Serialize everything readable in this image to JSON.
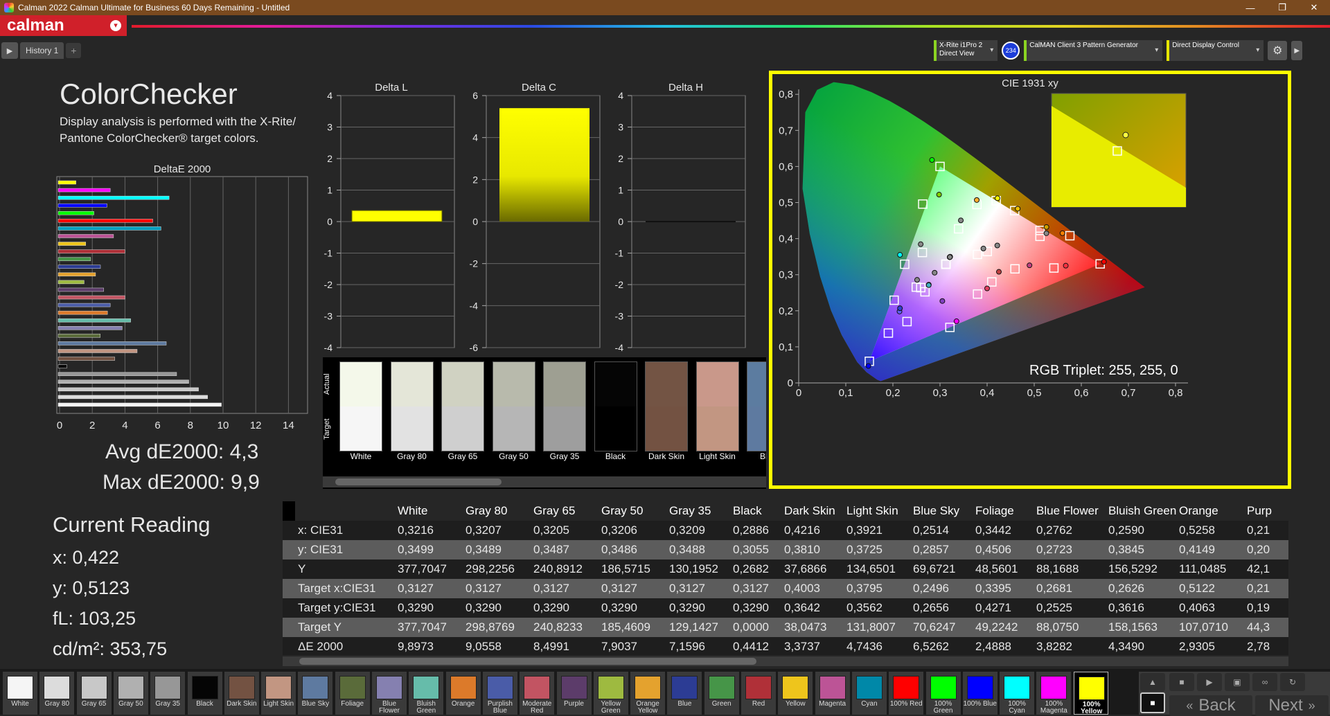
{
  "window": {
    "title": "Calman 2022 Calman Ultimate for Business 60 Days Remaining  - Untitled",
    "min": "—",
    "max": "❐",
    "close": "✕"
  },
  "app": {
    "logo": "calman",
    "logo_chevron": "▾"
  },
  "tabs": {
    "play": "▶",
    "history": "History 1",
    "add": "+"
  },
  "devices": {
    "meter_line1": "X-Rite i1Pro 2",
    "meter_line2": "Direct View",
    "badge": "234",
    "pattern": "CalMAN Client 3 Pattern Generator",
    "display": "Direct Display Control",
    "dropdown": "▾",
    "gear": "⚙",
    "side": "▶"
  },
  "heading": {
    "title": "ColorChecker",
    "desc": "Display analysis is performed with the X-Rite/ Pantone ColorChecker® target colors."
  },
  "deltae_chart": {
    "title": "DeltaE 2000",
    "ticks": [
      "0",
      "2",
      "4",
      "6",
      "8",
      "10",
      "12",
      "14"
    ],
    "xmax": 15
  },
  "stats": {
    "avg": "Avg dE2000: 4,3",
    "max": "Max dE2000: 9,9"
  },
  "delta_l": {
    "title": "Delta L",
    "ticks": [
      "4",
      "3",
      "2",
      "1",
      "0",
      "-1",
      "-2",
      "-3",
      "-4"
    ]
  },
  "delta_c": {
    "title": "Delta C",
    "ticks": [
      "6",
      "4",
      "2",
      "0",
      "-2",
      "-4",
      "-6"
    ]
  },
  "delta_h": {
    "title": "Delta H",
    "ticks": [
      "4",
      "3",
      "2",
      "1",
      "0",
      "-1",
      "-2",
      "-3",
      "-4"
    ]
  },
  "swatches": {
    "actual_label": "Actual",
    "target_label": "Target",
    "items": [
      {
        "label": "White",
        "actual": "#f4f8ea",
        "target": "#f6f6f6"
      },
      {
        "label": "Gray 80",
        "actual": "#e4e6d8",
        "target": "#e2e2e2"
      },
      {
        "label": "Gray 65",
        "actual": "#d0d2c2",
        "target": "#cfcfcf"
      },
      {
        "label": "Gray 50",
        "actual": "#b8baac",
        "target": "#b6b6b6"
      },
      {
        "label": "Gray 35",
        "actual": "#9e9f92",
        "target": "#9e9e9e"
      },
      {
        "label": "Black",
        "actual": "#050505",
        "target": "#000000"
      },
      {
        "label": "Dark Skin",
        "actual": "#735444",
        "target": "#735242"
      },
      {
        "label": "Light Skin",
        "actual": "#c9988a",
        "target": "#c29682"
      },
      {
        "label": "Blue",
        "actual": "#5c7ca0",
        "target": "#5e7aa0"
      }
    ]
  },
  "cie": {
    "title": "CIE 1931 xy",
    "rgb_triplet": "RGB Triplet: 255, 255, 0",
    "xticks": [
      "0",
      "0,1",
      "0,2",
      "0,3",
      "0,4",
      "0,5",
      "0,6",
      "0,7",
      "0,8"
    ],
    "yticks": [
      "0",
      "0,1",
      "0,2",
      "0,3",
      "0,4",
      "0,5",
      "0,6",
      "0,7",
      "0,8"
    ]
  },
  "reading": {
    "title": "Current Reading",
    "x": "x: 0,422",
    "y": "y: 0,5123",
    "fl": "fL: 103,25",
    "cd": "cd/m²: 353,75"
  },
  "table": {
    "columns": [
      "White",
      "Gray 80",
      "Gray 65",
      "Gray 50",
      "Gray 35",
      "Black",
      "Dark Skin",
      "Light Skin",
      "Blue Sky",
      "Foliage",
      "Blue Flower",
      "Bluish Green",
      "Orange",
      "Purp"
    ],
    "rows": [
      {
        "label": "x: CIE31",
        "values": [
          "0,3216",
          "0,3207",
          "0,3205",
          "0,3206",
          "0,3209",
          "0,2886",
          "0,4216",
          "0,3921",
          "0,2514",
          "0,3442",
          "0,2762",
          "0,2590",
          "0,5258",
          "0,21"
        ]
      },
      {
        "label": "y: CIE31",
        "values": [
          "0,3499",
          "0,3489",
          "0,3487",
          "0,3486",
          "0,3488",
          "0,3055",
          "0,3810",
          "0,3725",
          "0,2857",
          "0,4506",
          "0,2723",
          "0,3845",
          "0,4149",
          "0,20"
        ]
      },
      {
        "label": "Y",
        "values": [
          "377,7047",
          "298,2256",
          "240,8912",
          "186,5715",
          "130,1952",
          "0,2682",
          "37,6866",
          "134,6501",
          "69,6721",
          "48,5601",
          "88,1688",
          "156,5292",
          "111,0485",
          "42,1"
        ]
      },
      {
        "label": "Target x:CIE31",
        "values": [
          "0,3127",
          "0,3127",
          "0,3127",
          "0,3127",
          "0,3127",
          "0,3127",
          "0,4003",
          "0,3795",
          "0,2496",
          "0,3395",
          "0,2681",
          "0,2626",
          "0,5122",
          "0,21"
        ]
      },
      {
        "label": "Target y:CIE31",
        "values": [
          "0,3290",
          "0,3290",
          "0,3290",
          "0,3290",
          "0,3290",
          "0,3290",
          "0,3642",
          "0,3562",
          "0,2656",
          "0,4271",
          "0,2525",
          "0,3616",
          "0,4063",
          "0,19"
        ]
      },
      {
        "label": "Target Y",
        "values": [
          "377,7047",
          "298,8769",
          "240,8233",
          "185,4609",
          "129,1427",
          "0,0000",
          "38,0473",
          "131,8007",
          "70,6247",
          "49,2242",
          "88,0750",
          "158,1563",
          "107,0710",
          "44,3"
        ]
      },
      {
        "label": "ΔE 2000",
        "values": [
          "9,8973",
          "9,0558",
          "8,4991",
          "7,9037",
          "7,1596",
          "0,4412",
          "3,3737",
          "4,7436",
          "6,5262",
          "2,4888",
          "3,8282",
          "4,3490",
          "2,9305",
          "2,78"
        ]
      }
    ]
  },
  "patches": [
    {
      "label": "White",
      "color": "#f5f5f5"
    },
    {
      "label": "Gray 80",
      "color": "#dcdcdc"
    },
    {
      "label": "Gray 65",
      "color": "#c8c8c8"
    },
    {
      "label": "Gray 50",
      "color": "#b0b0b0"
    },
    {
      "label": "Gray 35",
      "color": "#979797"
    },
    {
      "label": "Black",
      "color": "#050505"
    },
    {
      "label": "Dark Skin",
      "color": "#735242"
    },
    {
      "label": "Light Skin",
      "color": "#c29682"
    },
    {
      "label": "Blue Sky",
      "color": "#5e7aa0"
    },
    {
      "label": "Foliage",
      "color": "#5a6b3a"
    },
    {
      "label": "Blue Flower",
      "color": "#8580b0"
    },
    {
      "label": "Bluish Green",
      "color": "#66bcaa"
    },
    {
      "label": "Orange",
      "color": "#dc7a2a"
    },
    {
      "label": "Purplish Blue",
      "color": "#4a5ca8"
    },
    {
      "label": "Moderate Red",
      "color": "#c25462"
    },
    {
      "label": "Purple",
      "color": "#5c3c6a"
    },
    {
      "label": "Yellow Green",
      "color": "#9eba40"
    },
    {
      "label": "Orange Yellow",
      "color": "#e4a22e"
    },
    {
      "label": "Blue",
      "color": "#2c3c94"
    },
    {
      "label": "Green",
      "color": "#469548"
    },
    {
      "label": "Red",
      "color": "#b03038"
    },
    {
      "label": "Yellow",
      "color": "#eec51c"
    },
    {
      "label": "Magenta",
      "color": "#bc5496"
    },
    {
      "label": "Cyan",
      "color": "#0088a8"
    },
    {
      "label": "100% Red",
      "color": "#ff0000"
    },
    {
      "label": "100% Green",
      "color": "#00ff00"
    },
    {
      "label": "100% Blue",
      "color": "#0000ff"
    },
    {
      "label": "100% Cyan",
      "color": "#00ffff"
    },
    {
      "label": "100% Magenta",
      "color": "#ff00ff"
    },
    {
      "label": "100% Yellow",
      "color": "#ffff00"
    }
  ],
  "nav": {
    "back": "Back",
    "next": "Next",
    "up": "▲",
    "stop": "■",
    "play": "▶",
    "save": "▣",
    "loop": "∞",
    "refresh": "↻"
  }
}
